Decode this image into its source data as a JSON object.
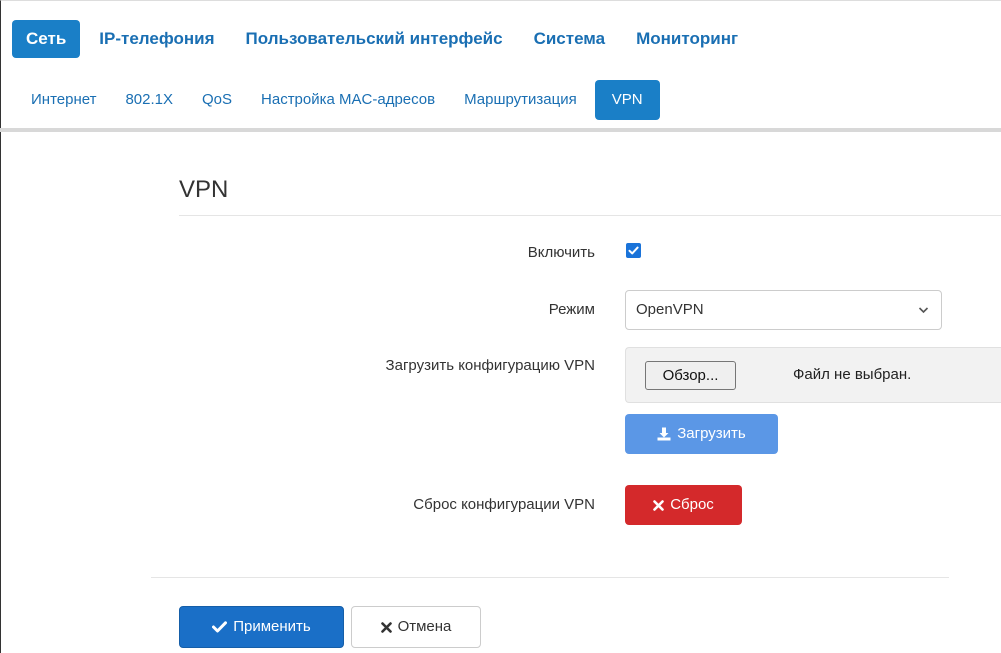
{
  "top_nav": {
    "tabs": [
      {
        "label": "Сеть",
        "active": true
      },
      {
        "label": "IP-телефония",
        "active": false
      },
      {
        "label": "Пользовательский интерфейс",
        "active": false
      },
      {
        "label": "Система",
        "active": false
      },
      {
        "label": "Мониторинг",
        "active": false
      }
    ]
  },
  "sub_nav": {
    "tabs": [
      {
        "label": "Интернет",
        "active": false
      },
      {
        "label": "802.1X",
        "active": false
      },
      {
        "label": "QoS",
        "active": false
      },
      {
        "label": "Настройка MAC-адресов",
        "active": false
      },
      {
        "label": "Маршрутизация",
        "active": false
      },
      {
        "label": "VPN",
        "active": true
      }
    ]
  },
  "section": {
    "title": "VPN"
  },
  "form": {
    "enable_label": "Включить",
    "enable_checked": true,
    "mode_label": "Режим",
    "mode_value": "OpenVPN",
    "upload_config_label": "Загрузить конфигурацию VPN",
    "browse_button": "Обзор...",
    "file_status": "Файл не выбран.",
    "upload_button": "Загрузить",
    "reset_config_label": "Сброс конфигурации VPN",
    "reset_button": "Сброс"
  },
  "actions": {
    "apply": "Применить",
    "cancel": "Отмена"
  },
  "colors": {
    "primary": "#1a7fc7",
    "upload": "#5b97e6",
    "danger": "#d4292b",
    "checkbox": "#1a73d9"
  },
  "icons": {
    "upload": "download-icon",
    "reset": "close-icon",
    "apply": "check-icon",
    "cancel": "close-icon",
    "select": "chevron-down-icon"
  }
}
